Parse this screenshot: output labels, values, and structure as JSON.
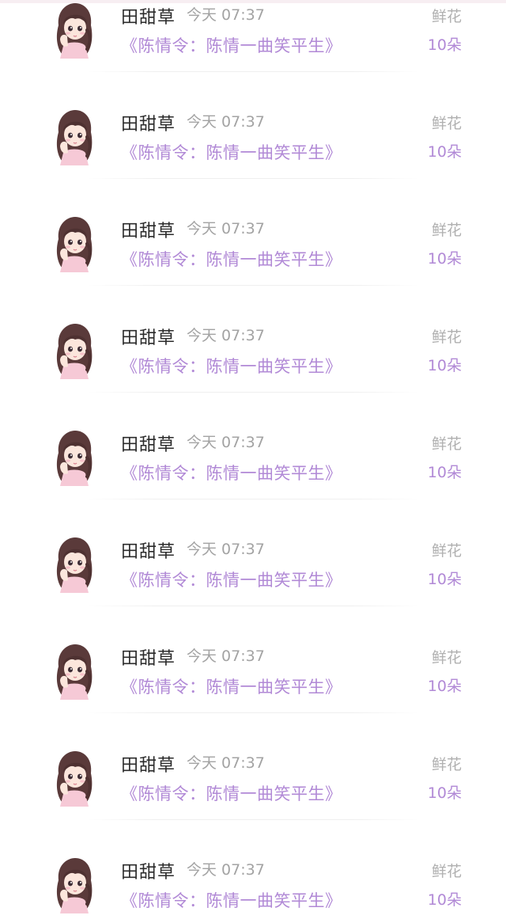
{
  "items": [
    {
      "user": "田甜草",
      "time": "今天 07:37",
      "book": "《陈情令：陈情一曲笑平生》",
      "gift": "鲜花",
      "amount": "10朵",
      "avatar_icon": "girl-avatar-icon"
    },
    {
      "user": "田甜草",
      "time": "今天 07:37",
      "book": "《陈情令：陈情一曲笑平生》",
      "gift": "鲜花",
      "amount": "10朵",
      "avatar_icon": "girl-avatar-icon"
    },
    {
      "user": "田甜草",
      "time": "今天 07:37",
      "book": "《陈情令：陈情一曲笑平生》",
      "gift": "鲜花",
      "amount": "10朵",
      "avatar_icon": "girl-avatar-icon"
    },
    {
      "user": "田甜草",
      "time": "今天 07:37",
      "book": "《陈情令：陈情一曲笑平生》",
      "gift": "鲜花",
      "amount": "10朵",
      "avatar_icon": "girl-avatar-icon"
    },
    {
      "user": "田甜草",
      "time": "今天 07:37",
      "book": "《陈情令：陈情一曲笑平生》",
      "gift": "鲜花",
      "amount": "10朵",
      "avatar_icon": "girl-avatar-icon"
    },
    {
      "user": "田甜草",
      "time": "今天 07:37",
      "book": "《陈情令：陈情一曲笑平生》",
      "gift": "鲜花",
      "amount": "10朵",
      "avatar_icon": "girl-avatar-icon"
    },
    {
      "user": "田甜草",
      "time": "今天 07:37",
      "book": "《陈情令：陈情一曲笑平生》",
      "gift": "鲜花",
      "amount": "10朵",
      "avatar_icon": "girl-avatar-icon"
    },
    {
      "user": "田甜草",
      "time": "今天 07:37",
      "book": "《陈情令：陈情一曲笑平生》",
      "gift": "鲜花",
      "amount": "10朵",
      "avatar_icon": "girl-avatar-icon"
    },
    {
      "user": "田甜草",
      "time": "今天 07:37",
      "book": "《陈情令：陈情一曲笑平生》",
      "gift": "鲜花",
      "amount": "10朵",
      "avatar_icon": "girl-avatar-icon"
    }
  ],
  "colors": {
    "username": "#2b2b2b",
    "timestamp": "#a3a3a3",
    "accent": "#b189d6",
    "gift_label": "#b0b0b0",
    "divider": "#efefef"
  }
}
